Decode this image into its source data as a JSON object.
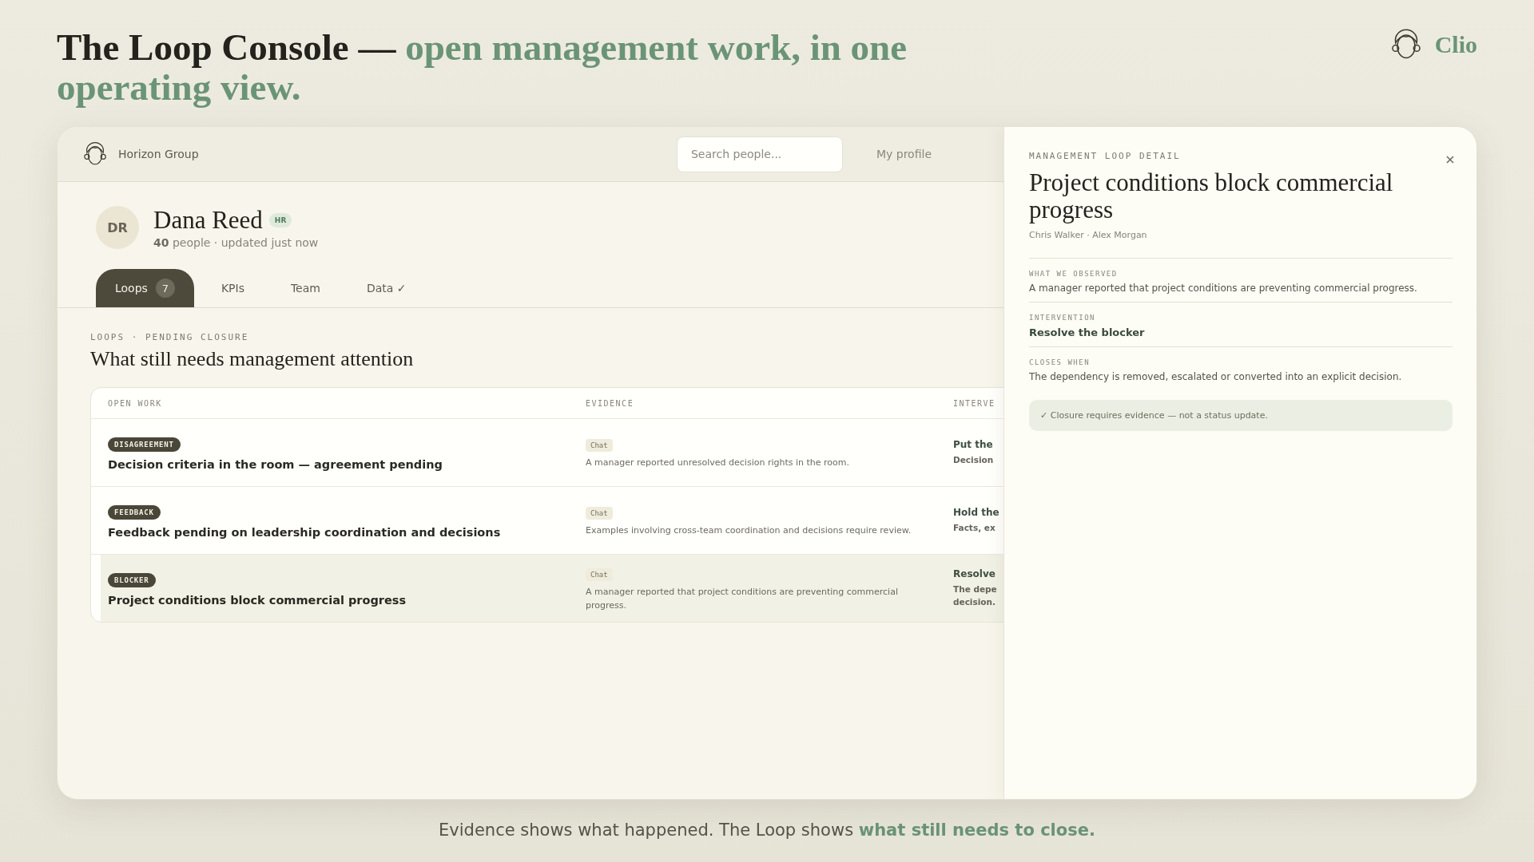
{
  "headline": {
    "lead": "The Loop Console —",
    "accent": "open management work, in one operating view."
  },
  "brand": {
    "name": "Clio"
  },
  "topbar": {
    "org": "Horizon Group",
    "search": {
      "placeholder": "Search people..."
    },
    "links": [
      "My profile"
    ]
  },
  "profile": {
    "initials": "DR",
    "name": "Dana Reed",
    "badge": "HR",
    "count": "40",
    "meta": "people · updated just now"
  },
  "tabs": [
    {
      "label": "Loops",
      "count": "7",
      "selected": true
    },
    {
      "label": "KPIs",
      "selected": false
    },
    {
      "label": "Team",
      "selected": false
    },
    {
      "label": "Data ✓",
      "selected": false
    }
  ],
  "section": {
    "eyebrow": "LOOPS · PENDING CLOSURE",
    "title": "What still needs management attention"
  },
  "table": {
    "columns": [
      "OPEN WORK",
      "EVIDENCE",
      "INTERVE"
    ],
    "rows": [
      {
        "tag": "DISAGREEMENT",
        "title": "Decision criteria in the room — agreement pending",
        "source": "Chat",
        "evidence": "A manager reported unresolved decision rights in the room.",
        "intervention": "Put the",
        "note": [
          "Decision"
        ],
        "selected": false
      },
      {
        "tag": "FEEDBACK",
        "title": "Feedback pending on leadership coordination and decisions",
        "source": "Chat",
        "evidence": "Examples involving cross-team coordination and decisions require review.",
        "intervention": "Hold the",
        "note": [
          "Facts, ex"
        ],
        "selected": false
      },
      {
        "tag": "BLOCKER",
        "title": "Project conditions block commercial progress",
        "source": "Chat",
        "evidence": "A manager reported that project conditions are preventing commercial progress.",
        "intervention": "Resolve",
        "note": [
          "The depe",
          "decision."
        ],
        "selected": true
      }
    ]
  },
  "detail": {
    "eyebrow": "MANAGEMENT LOOP DETAIL",
    "title": "Project conditions block commercial progress",
    "people": "Chris Walker · Alex Morgan",
    "sections": [
      {
        "label": "WHAT WE OBSERVED",
        "text": "A manager reported that project conditions are preventing commercial progress.",
        "kind": "plain"
      },
      {
        "label": "INTERVENTION",
        "text": "Resolve the blocker",
        "kind": "strong"
      },
      {
        "label": "CLOSES WHEN",
        "text": "The dependency is removed, escalated or converted into an explicit decision.",
        "kind": "plain"
      }
    ],
    "callout": "✓ Closure requires evidence — not a status update."
  },
  "footer": {
    "text": "Evidence shows what happened. The Loop shows **what still needs to close.**"
  }
}
